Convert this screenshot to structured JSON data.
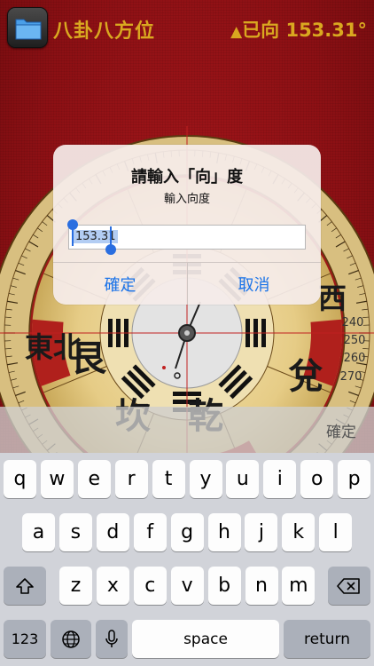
{
  "app": {
    "title": "八卦八方位",
    "heading_triangle": "▲",
    "heading_text": "已向 153.31°"
  },
  "colors": {
    "accent_gold": "#d9a820",
    "background_red": "#8c1014",
    "ios_blue": "#1a73e8",
    "selection_handle": "#2a6ee0"
  },
  "compass": {
    "trigram_labels": [
      "坎",
      "乾",
      "兌",
      "艮",
      "東北",
      "西"
    ],
    "degree_labels": [
      "240",
      "250",
      "260",
      "270"
    ]
  },
  "alert": {
    "title": "請輸入「向」度",
    "message": "輸入向度",
    "input_value": "153.31",
    "ok_label": "確定",
    "cancel_label": "取消"
  },
  "keyboard": {
    "accessory_done": "確定",
    "row1": [
      "q",
      "w",
      "e",
      "r",
      "t",
      "y",
      "u",
      "i",
      "o",
      "p"
    ],
    "row2": [
      "a",
      "s",
      "d",
      "f",
      "g",
      "h",
      "j",
      "k",
      "l"
    ],
    "row3": [
      "z",
      "x",
      "c",
      "v",
      "b",
      "n",
      "m"
    ],
    "numbers_label": "123",
    "space_label": "space",
    "return_label": "return",
    "shift_icon": "shift-icon",
    "delete_icon": "delete-icon",
    "globe_icon": "globe-icon",
    "mic_icon": "microphone-icon"
  }
}
